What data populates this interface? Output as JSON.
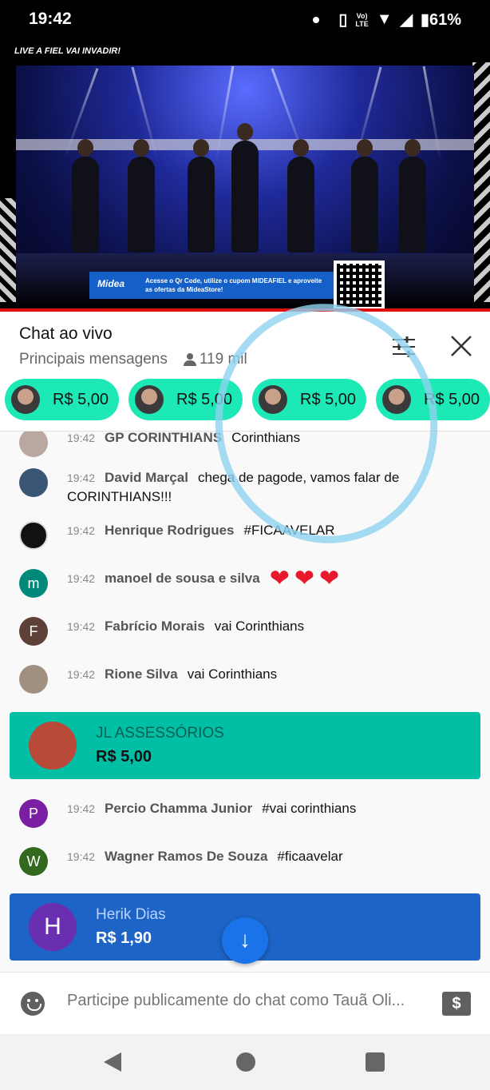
{
  "status_bar": {
    "time": "19:42",
    "network_top": "Vo)",
    "network_bottom": "LTE",
    "battery": "61%"
  },
  "video": {
    "overlay_title": "A FIEL VAI INVADIR!",
    "live_badge": "LIVE",
    "sponsor": "Midea",
    "sponsor_text": "Acesse o Qr Code, utilize o cupom MIDEAFIEL e aproveite as ofertas da MideaStore!"
  },
  "chat": {
    "title": "Chat ao vivo",
    "mode": "Principais mensagens",
    "viewers": "119 mil"
  },
  "ticker": [
    {
      "amount": "R$ 5,00"
    },
    {
      "amount": "R$ 5,00"
    },
    {
      "amount": "R$ 5,00"
    },
    {
      "amount": "R$ 5,00"
    }
  ],
  "messages": [
    {
      "time": "19:42",
      "author": "GP CORINTHIANS",
      "text": "Corinthians",
      "initial": "",
      "avatar_color": "#b8a8a0"
    },
    {
      "time": "19:42",
      "author": "David Marçal",
      "text": "chega de pagode, vamos falar de CORINTHIANS!!!",
      "initial": "",
      "avatar_color": "#3b5574"
    },
    {
      "time": "19:42",
      "author": "Henrique Rodrigues",
      "text": "#FICAAVELAR",
      "initial": "",
      "avatar_color": "#111111"
    },
    {
      "time": "19:42",
      "author": "manoel de sousa e silva",
      "text": "❤❤❤",
      "initial": "m",
      "avatar_color": "#00897b"
    },
    {
      "time": "19:42",
      "author": "Fabrício Morais",
      "text": "vai Corinthians",
      "initial": "F",
      "avatar_color": "#5d4037"
    },
    {
      "time": "19:42",
      "author": "Rione Silva",
      "text": "vai Corinthians",
      "initial": "",
      "avatar_color": "#a09080"
    },
    {
      "time": "19:42",
      "author": "Percio Chamma Junior",
      "text": "#vai corinthians",
      "initial": "P",
      "avatar_color": "#7b1fa2"
    },
    {
      "time": "19:42",
      "author": "Wagner Ramos De Souza",
      "text": "#ficaavelar",
      "initial": "W",
      "avatar_color": "#33691e"
    }
  ],
  "super_chats": [
    {
      "name": "JL ASSESSÓRIOS",
      "amount": "R$ 5,00",
      "bg": "#00bfa5",
      "name_color": "#0d5e52",
      "amount_color": "#111111",
      "initial": ""
    },
    {
      "name": "Herik Dias",
      "amount": "R$ 1,90",
      "bg": "#1e63c6",
      "name_color": "#b7d3ff",
      "amount_color": "#ffffff",
      "initial": "H"
    }
  ],
  "input": {
    "placeholder": "Participe publicamente do chat como Tauã Oli..."
  },
  "icons": {
    "filter": "sliders-icon",
    "close": "close-icon",
    "emoji": "emoji-icon",
    "scroll": "arrow-down-icon",
    "money": "money-icon"
  }
}
